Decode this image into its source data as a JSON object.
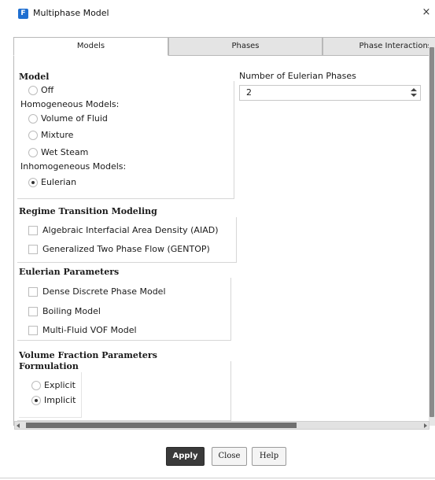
{
  "window": {
    "title": "Multiphase Model",
    "app_icon": "fluent-logo-icon",
    "app_icon_glyph": "F",
    "close_glyph": "×"
  },
  "tabs": [
    {
      "label": "Models",
      "active": true
    },
    {
      "label": "Phases",
      "active": false
    },
    {
      "label": "Phase Interactions",
      "active": false
    }
  ],
  "model": {
    "title": "Model",
    "off_label": "Off",
    "homogeneous_label": "Homogeneous Models:",
    "vof_label": "Volume of Fluid",
    "mixture_label": "Mixture",
    "wet_steam_label": "Wet Steam",
    "inhomogeneous_label": "Inhomogeneous Models:",
    "eulerian_label": "Eulerian",
    "selected": "Eulerian"
  },
  "phases_count": {
    "label": "Number of Eulerian Phases",
    "value": "2"
  },
  "regime": {
    "title": "Regime Transition Modeling",
    "aiad_label": "Algebraic Interfacial Area Density (AIAD)",
    "gentop_label": "Generalized Two Phase Flow (GENTOP)"
  },
  "eulerian_params": {
    "title": "Eulerian Parameters",
    "dense_dpm_label": "Dense Discrete Phase Model",
    "boiling_label": "Boiling Model",
    "multi_fluid_label": "Multi-Fluid VOF Model"
  },
  "volume_fraction": {
    "title": "Volume Fraction Parameters",
    "formulation_title": "Formulation",
    "explicit_label": "Explicit",
    "implicit_label": "Implicit",
    "selected": "Implicit"
  },
  "buttons": {
    "apply": "Apply",
    "close": "Close",
    "help": "Help"
  },
  "colors": {
    "accent": "#1f6fd1",
    "primary_button": "#3a3a3a"
  }
}
